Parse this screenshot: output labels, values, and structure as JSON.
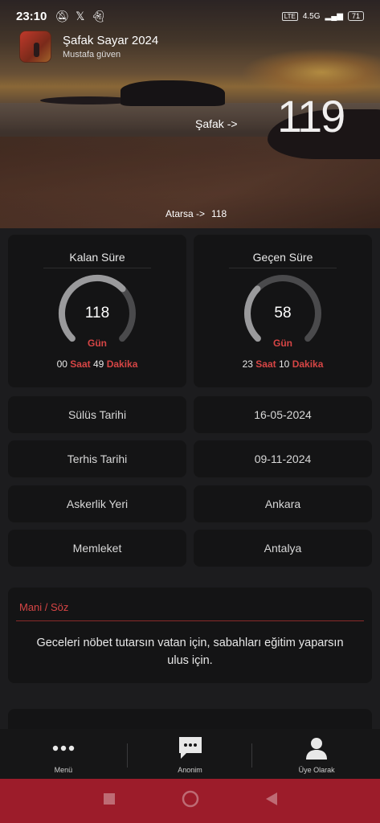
{
  "status_bar": {
    "time": "23:10",
    "network": "4.5G",
    "battery": "71"
  },
  "app": {
    "title": "Şafak Sayar 2024",
    "author": "Mustafa güven"
  },
  "hero": {
    "safak_label": "Şafak ->",
    "safak_value": "119",
    "atarsa_label": "Atarsa ->",
    "atarsa_value": "118"
  },
  "kalan": {
    "title": "Kalan Süre",
    "days": "118",
    "unit": "Gün",
    "hours": "00",
    "hours_label": "Saat",
    "minutes": "49",
    "minutes_label": "Dakika",
    "fraction": 0.67
  },
  "gecen": {
    "title": "Geçen Süre",
    "days": "58",
    "unit": "Gün",
    "hours": "23",
    "hours_label": "Saat",
    "minutes": "10",
    "minutes_label": "Dakika",
    "fraction": 0.33
  },
  "info_rows": [
    {
      "label": "Sülüs Tarihi",
      "value": "16-05-2024"
    },
    {
      "label": "Terhis Tarihi",
      "value": "09-11-2024"
    },
    {
      "label": "Askerlik Yeri",
      "value": "Ankara"
    },
    {
      "label": "Memleket",
      "value": "Antalya"
    }
  ],
  "mani": {
    "title": "Mani / Söz",
    "text": "Geceleri nöbet tutarsın vatan için, sabahları eğitim yaparsın ulus için."
  },
  "bottom_nav": [
    {
      "label": "Menü",
      "icon": "more-dots-icon"
    },
    {
      "label": "Anonim",
      "icon": "chat-bubble-icon"
    },
    {
      "label": "Üye Olarak",
      "icon": "person-icon"
    }
  ],
  "colors": {
    "accent": "#d64545",
    "gauge_track": "#4a4a4c",
    "gauge_fill": "#9a9a9c",
    "system_nav": "#9c1c2a"
  }
}
